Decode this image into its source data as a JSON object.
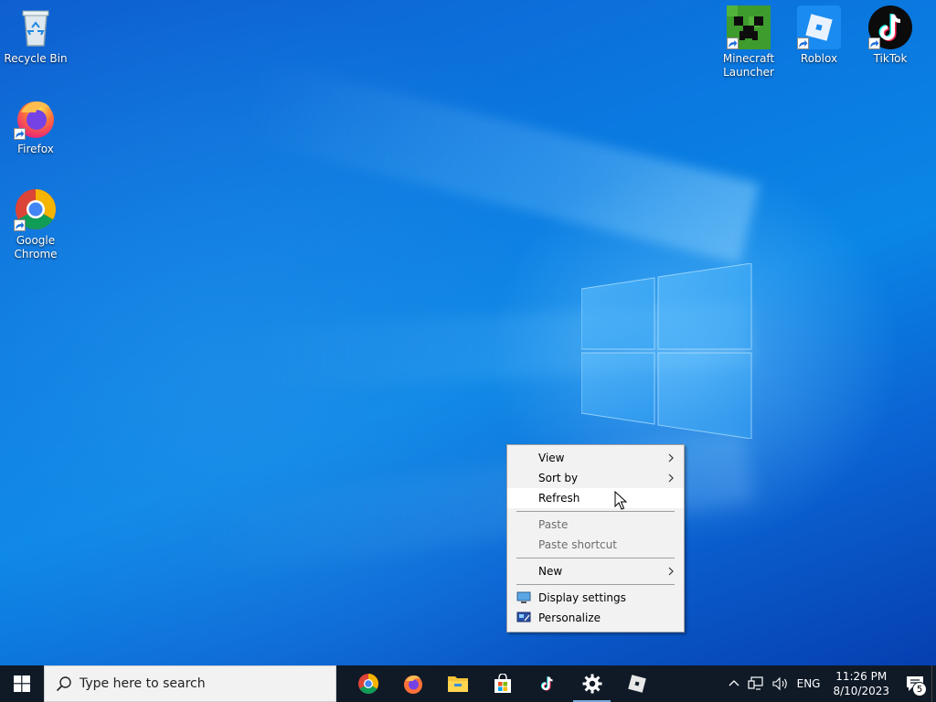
{
  "desktop": {
    "left_icons": [
      {
        "label": "Recycle Bin",
        "icon": "recycle-bin-icon"
      },
      {
        "label": "Firefox",
        "icon": "firefox-icon",
        "shortcut": true
      },
      {
        "label": "Google Chrome",
        "icon": "chrome-icon",
        "shortcut": true
      }
    ],
    "right_icons": [
      {
        "label": "Minecraft Launcher",
        "icon": "minecraft-icon",
        "shortcut": true
      },
      {
        "label": "Roblox",
        "icon": "roblox-icon",
        "shortcut": true
      },
      {
        "label": "TikTok",
        "icon": "tiktok-icon",
        "shortcut": true
      }
    ]
  },
  "context_menu": {
    "items": [
      {
        "label": "View",
        "submenu": true
      },
      {
        "label": "Sort by",
        "submenu": true
      },
      {
        "label": "Refresh",
        "hovered": true
      },
      {
        "label": "Paste",
        "disabled": true
      },
      {
        "label": "Paste shortcut",
        "disabled": true
      },
      {
        "label": "New",
        "submenu": true
      },
      {
        "label": "Display settings",
        "icon": "display-icon"
      },
      {
        "label": "Personalize",
        "icon": "personalize-icon"
      }
    ]
  },
  "taskbar": {
    "search_placeholder": "Type here to search",
    "pinned_apps": [
      "chrome-icon",
      "firefox-icon",
      "file-explorer-icon",
      "store-icon",
      "tiktok-icon",
      "settings-icon",
      "roblox-icon"
    ],
    "active_app": "settings-icon",
    "tray": {
      "language": "ENG",
      "time": "11:26 PM",
      "date": "8/10/2023",
      "notification_count": "5"
    }
  },
  "colors": {
    "taskbar": "#101a27",
    "menu_bg": "#f2f2f2",
    "wallpaper_blue": "#0a79e0"
  }
}
